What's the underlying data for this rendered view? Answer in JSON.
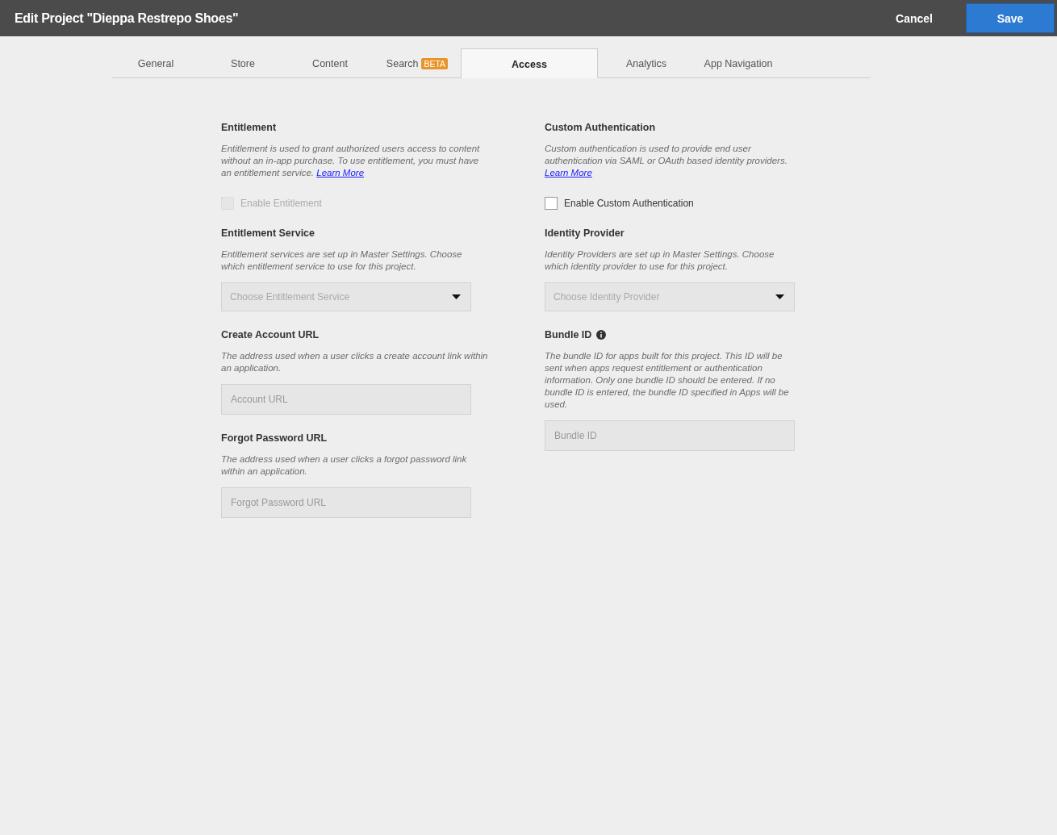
{
  "header": {
    "title": "Edit Project \"Dieppa Restrepo Shoes\"",
    "cancel": "Cancel",
    "save": "Save"
  },
  "tabs": [
    {
      "label": "General",
      "selected": false
    },
    {
      "label": "Store",
      "selected": false
    },
    {
      "label": "Content",
      "selected": false
    },
    {
      "label": "Search",
      "badge": "BETA",
      "selected": false
    },
    {
      "label": "Access",
      "selected": true
    },
    {
      "label": "Analytics",
      "selected": false
    },
    {
      "label": "App Navigation",
      "selected": false
    }
  ],
  "columns": [
    [
      {
        "title": "Entitlement",
        "description": "Entitlement is used to grant authorized users access to content without an in-app purchase. To use entitlement, you must have an entitlement service.",
        "link": "Learn More",
        "control": {
          "kind": "checkbox",
          "label": "Enable Entitlement",
          "checked": false,
          "disabled": true
        }
      },
      {
        "title": "Entitlement Service",
        "description": "Entitlement services are set up in Master Settings. Choose which entitlement service to use for this project.",
        "control": {
          "kind": "select",
          "placeholder": "Choose Entitlement Service"
        }
      },
      {
        "title": "Create Account URL",
        "description": "The address used when a user clicks a create account link within an application.",
        "control": {
          "kind": "input",
          "placeholder": "Account URL"
        }
      },
      {
        "title": "Forgot Password URL",
        "description": "The address used when a user clicks a forgot password link within an application.",
        "control": {
          "kind": "input",
          "placeholder": "Forgot Password URL"
        }
      }
    ],
    [
      {
        "title": "Custom Authentication",
        "description": "Custom authentication is used to provide end user authentication via SAML or OAuth based identity providers.",
        "link": "Learn More",
        "control": {
          "kind": "checkbox",
          "label": "Enable Custom Authentication",
          "checked": false,
          "disabled": false
        }
      },
      {
        "title": "Identity Provider",
        "description": "Identity Providers are set up in Master Settings.  Choose which identity provider to use for this project.",
        "control": {
          "kind": "select",
          "placeholder": "Choose Identity Provider"
        }
      },
      {
        "title": "Bundle ID",
        "info": true,
        "description": "The bundle ID for apps built for this project. This ID will be sent when apps request entitlement or authentication information. Only one bundle ID should be entered. If no bundle ID is entered, the bundle ID specified in Apps will be used.",
        "control": {
          "kind": "input",
          "placeholder": "Bundle ID"
        }
      }
    ]
  ]
}
